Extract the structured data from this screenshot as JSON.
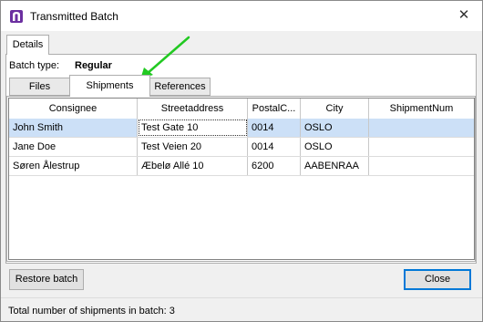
{
  "window": {
    "title": "Transmitted Batch",
    "close_glyph": "✕",
    "app_icon": "app-logo-icon"
  },
  "outer_tabs": [
    {
      "label": "Details"
    }
  ],
  "batch": {
    "label": "Batch type:",
    "value": "Regular"
  },
  "inner_tabs": [
    {
      "label": "Files"
    },
    {
      "label": "Shipments",
      "active": true
    },
    {
      "label": "References"
    }
  ],
  "grid": {
    "columns": [
      "Consignee",
      "Streetaddress",
      "PostalC...",
      "City",
      "ShipmentNum"
    ],
    "rows": [
      {
        "consignee": "John Smith",
        "street": "Test Gate 10",
        "postal": "0014",
        "city": "OSLO",
        "shipment": "",
        "selected": true
      },
      {
        "consignee": "Jane Doe",
        "street": "Test Veien 20",
        "postal": "0014",
        "city": "OSLO",
        "shipment": ""
      },
      {
        "consignee": "Søren Ålestrup",
        "street": "Æbelø Allé 10",
        "postal": "6200",
        "city": "AABENRAA",
        "shipment": ""
      }
    ]
  },
  "buttons": {
    "restore": "Restore batch",
    "close": "Close"
  },
  "status": {
    "text": "Total number of shipments in batch: 3"
  },
  "colors": {
    "selection": "#cce0f7",
    "annotation_arrow": "#22c922",
    "app_icon": "#6b2fa0"
  }
}
